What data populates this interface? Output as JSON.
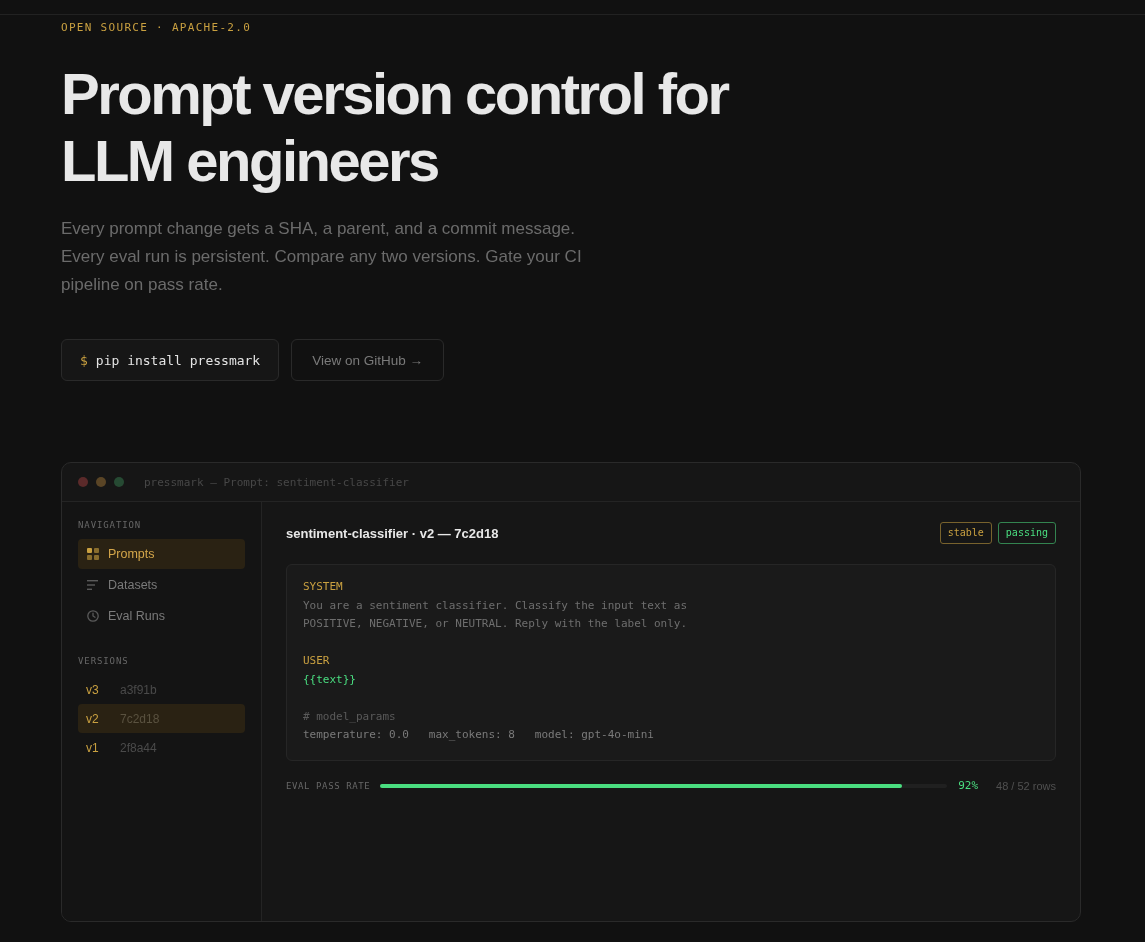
{
  "hero": {
    "eyebrow": "OPEN SOURCE · APACHE-2.0",
    "title": "Prompt version control for LLM engineers",
    "description": "Every prompt change gets a SHA, a parent, and a commit message. Every eval run is persistent. Compare any two versions. Gate your CI pipeline on pass rate.",
    "install": {
      "prompt": "$",
      "command": "pip install pressmark"
    },
    "github_link": "View on GitHub →"
  },
  "window": {
    "title": "pressmark — Prompt: sentiment-classifier"
  },
  "sidebar": {
    "navigation_heading": "NAVIGATION",
    "items": [
      {
        "label": "Prompts",
        "selected": true
      },
      {
        "label": "Datasets",
        "selected": false
      },
      {
        "label": "Eval Runs",
        "selected": false
      }
    ],
    "versions_heading": "VERSIONS",
    "versions": [
      {
        "version": "v3",
        "sha": "a3f91b",
        "selected": false
      },
      {
        "version": "v2",
        "sha": "7c2d18",
        "selected": true
      },
      {
        "version": "v1",
        "sha": "2f8a44",
        "selected": false
      }
    ]
  },
  "prompt": {
    "title": "sentiment-classifier · v2 — 7c2d18",
    "badges": [
      {
        "label": "stable",
        "color": "#c9a040"
      },
      {
        "label": "passing",
        "color": "#4ade80"
      }
    ],
    "blocks": [
      [
        {
          "kind": "role",
          "text": "SYSTEM"
        },
        {
          "kind": "text",
          "text": "You are a sentiment classifier. Classify the input text as"
        },
        {
          "kind": "text",
          "text": "POSITIVE, NEGATIVE, or NEUTRAL. Reply with the label only."
        }
      ],
      [
        {
          "kind": "role",
          "text": "USER"
        },
        {
          "kind": "variable",
          "text": "{{text}}"
        }
      ],
      [
        {
          "kind": "comment",
          "text": "# model_params"
        },
        {
          "kind": "params",
          "text": "temperature: 0.0   max_tokens: 8   model: gpt-4o-mini"
        }
      ]
    ]
  },
  "eval": {
    "label": "EVAL PASS RATE",
    "level": 0.92,
    "percent": "92%",
    "rows": "48 / 52 rows"
  }
}
